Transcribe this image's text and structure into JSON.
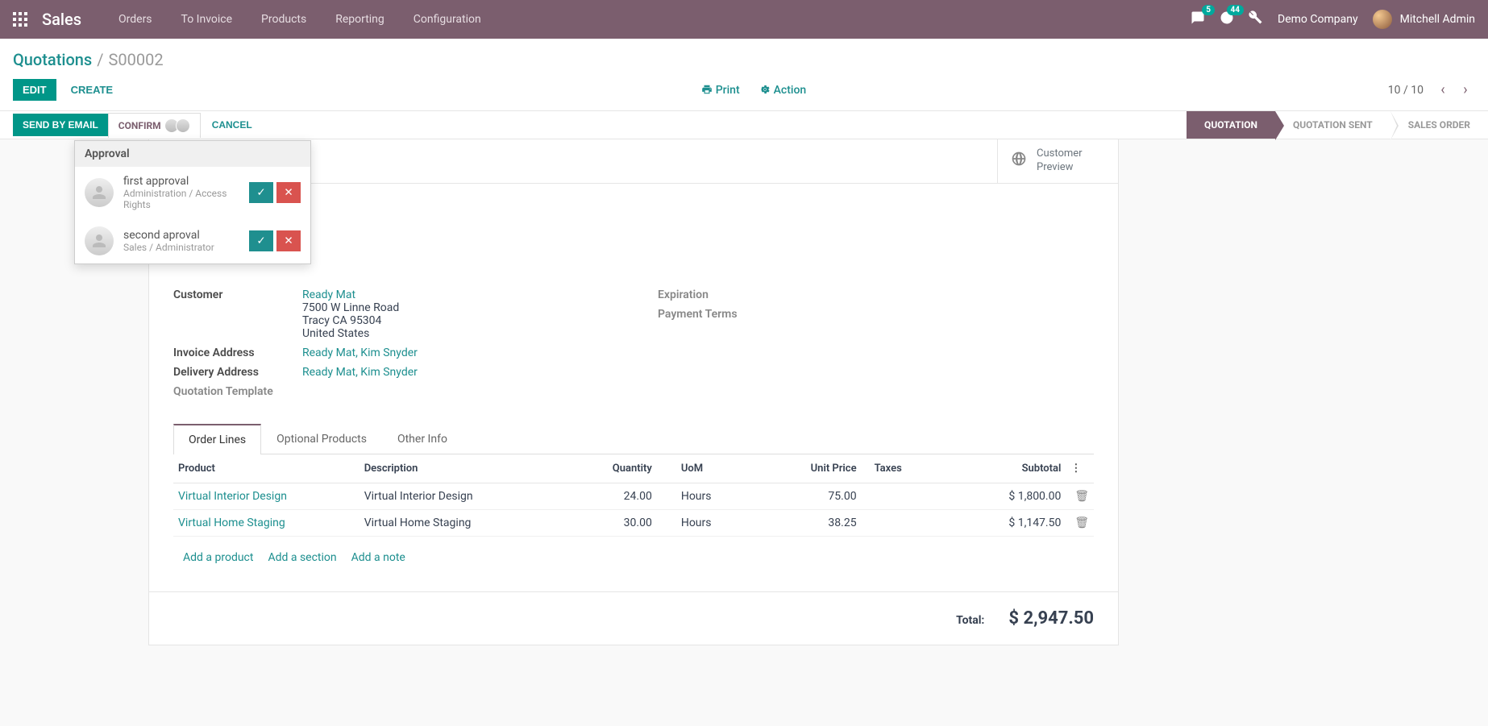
{
  "topbar": {
    "brand": "Sales",
    "nav": [
      "Orders",
      "To Invoice",
      "Products",
      "Reporting",
      "Configuration"
    ],
    "chat_badge": "5",
    "clock_badge": "44",
    "company": "Demo Company",
    "user": "Mitchell Admin"
  },
  "breadcrumb": {
    "root": "Quotations",
    "current": "S00002"
  },
  "controls": {
    "edit": "EDIT",
    "create": "CREATE",
    "print": "Print",
    "action": "Action",
    "pager": "10 / 10"
  },
  "statusbar": {
    "send": "SEND BY EMAIL",
    "confirm": "CONFIRM",
    "cancel": "CANCEL",
    "steps": [
      "QUOTATION",
      "QUOTATION SENT",
      "SALES ORDER"
    ]
  },
  "approval": {
    "header": "Approval",
    "items": [
      {
        "title": "first approval",
        "sub": "Administration / Access Rights"
      },
      {
        "title": "second aproval",
        "sub": "Sales / Administrator"
      }
    ]
  },
  "preview": {
    "line1": "Customer",
    "line2": "Preview"
  },
  "details": {
    "customer_label": "Customer",
    "customer_name": "Ready Mat",
    "addr1": "7500 W Linne Road",
    "addr2": "Tracy CA 95304",
    "addr3": "United States",
    "invoice_label": "Invoice Address",
    "invoice_value": "Ready Mat, Kim Snyder",
    "delivery_label": "Delivery Address",
    "delivery_value": "Ready Mat, Kim Snyder",
    "template_label": "Quotation Template",
    "expiration_label": "Expiration",
    "payment_label": "Payment Terms"
  },
  "tabs": [
    "Order Lines",
    "Optional Products",
    "Other Info"
  ],
  "table": {
    "headers": {
      "product": "Product",
      "description": "Description",
      "qty": "Quantity",
      "uom": "UoM",
      "price": "Unit Price",
      "taxes": "Taxes",
      "subtotal": "Subtotal"
    },
    "rows": [
      {
        "product": "Virtual Interior Design",
        "desc": "Virtual Interior Design",
        "qty": "24.00",
        "uom": "Hours",
        "price": "75.00",
        "taxes": "",
        "subtotal": "$ 1,800.00"
      },
      {
        "product": "Virtual Home Staging",
        "desc": "Virtual Home Staging",
        "qty": "30.00",
        "uom": "Hours",
        "price": "38.25",
        "taxes": "",
        "subtotal": "$ 1,147.50"
      }
    ],
    "add_product": "Add a product",
    "add_section": "Add a section",
    "add_note": "Add a note",
    "total_label": "Total:",
    "total_value": "$ 2,947.50"
  }
}
